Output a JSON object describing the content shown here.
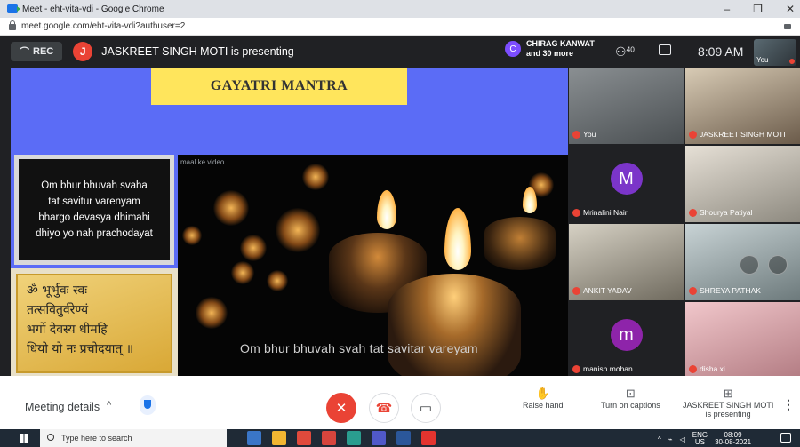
{
  "browser": {
    "title": "Meet - eht-vita-vdi - Google Chrome",
    "url": "meet.google.com/eht-vita-vdi?authuser=2",
    "controls": {
      "minimize": "–",
      "restore": "❐",
      "close": "✕"
    }
  },
  "topbar": {
    "rec_label": "REC",
    "presenter_initial": "J",
    "presenting_text": "JASKREET SINGH MOTI is presenting",
    "chip_initial": "C",
    "chip_line1": "CHIRAG KANWAT",
    "chip_line2": "and 30 more",
    "people_count": "40",
    "time": "8:09 AM",
    "self_label": "You"
  },
  "slide": {
    "banner": "GAYATRI MANTRA",
    "english_lines": [
      "Om bhur bhuvah svaha",
      "tat savitur varenyam",
      "bhargo devasya dhimahi",
      "dhiyo yo nah prachodayat"
    ],
    "sanskrit_lines": [
      "ॐ भूर्भुवः स्वः",
      "तत्सवितुर्वरेण्यं",
      "भर्गो देवस्य धीमहि",
      "धियो यो नः प्रचोदयात् ॥"
    ],
    "video_caption": "maal ke video",
    "subtitle": "Om bhur bhuvah svah tat savitar vareyam"
  },
  "participants": [
    {
      "name": "You",
      "avatar": "",
      "color": "#6b6f72"
    },
    {
      "name": "JASKREET SINGH MOTI",
      "avatar": "",
      "color": "#c9b9a0"
    },
    {
      "name": "Mrinalini Nair",
      "avatar": "M",
      "color": "#7b35c9"
    },
    {
      "name": "Shourya Patiyal",
      "avatar": "",
      "color": "#d9d2c5"
    },
    {
      "name": "ANKIT YADAV",
      "avatar": "",
      "color": "#c7c1b3"
    },
    {
      "name": "SHREYA PATHAK",
      "avatar": "",
      "color": "#b9c4c6"
    },
    {
      "name": "manish mohan",
      "avatar": "m",
      "color": "#8e24aa"
    },
    {
      "name": "disha xi",
      "avatar": "",
      "color": "#e8b4b8"
    }
  ],
  "bottombar": {
    "meeting_details": "Meeting details",
    "chevron": "^",
    "raise_hand": "Raise hand",
    "captions": "Turn on captions",
    "presenting_line1": "JASKREET SINGH MOTI",
    "presenting_line2": "is presenting",
    "more": "⋮"
  },
  "taskbar": {
    "search_placeholder": "Type here to search",
    "lang_line1": "ENG",
    "lang_line2": "US",
    "clock_line1": "08:09",
    "clock_line2": "30-08-2021"
  },
  "colors": {
    "stage_bg": "#5b6cf6",
    "banner_bg": "#ffe55c",
    "danger": "#ea4335"
  }
}
